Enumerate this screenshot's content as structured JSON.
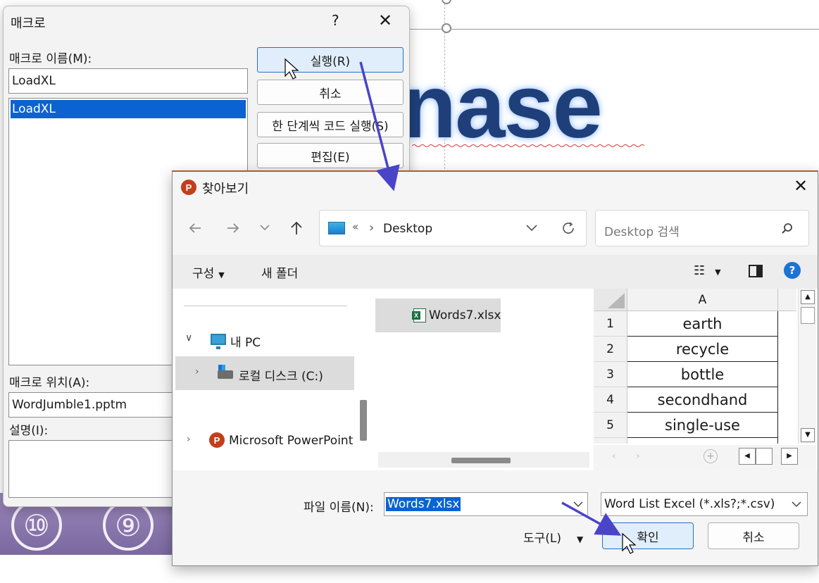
{
  "slide": {
    "word_fragment": "nase",
    "circle_numbers": [
      "⑩",
      "⑨"
    ]
  },
  "macro_dialog": {
    "title": "매크로",
    "help": "?",
    "close": "✕",
    "name_label": "매크로 이름(M):",
    "name_value": "LoadXL",
    "list_items": [
      "LoadXL"
    ],
    "location_label": "매크로 위치(A):",
    "location_value": "WordJumble1.pptm",
    "description_label": "설명(I):",
    "buttons": {
      "run": "실행(R)",
      "cancel": "취소",
      "step": "한 단계씩 코드 실행(S)",
      "edit": "편집(E)"
    }
  },
  "browse_dialog": {
    "app_icon": "P",
    "title": "찾아보기",
    "close": "✕",
    "breadcrumb_prefix": "«",
    "breadcrumb_sep": "›",
    "breadcrumb_current": "Desktop",
    "search_placeholder": "Desktop 검색",
    "toolbar": {
      "organize": "구성",
      "new_folder": "새 폴더"
    },
    "nav": {
      "this_pc": "내 PC",
      "local_disk": "로컬 디스크 (C:)",
      "powerpoint": "Microsoft PowerPoint"
    },
    "file": "Words7.xlsx",
    "preview": {
      "column_header": "A",
      "rows": [
        {
          "n": "1",
          "v": "earth"
        },
        {
          "n": "2",
          "v": "recycle"
        },
        {
          "n": "3",
          "v": "bottle"
        },
        {
          "n": "4",
          "v": "secondhand"
        },
        {
          "n": "5",
          "v": "single-use"
        }
      ]
    },
    "filename_label": "파일 이름(N):",
    "filename_value": "Words7.xlsx",
    "filetype_value": "Word List Excel (*.xls?;*.csv)",
    "tools_label": "도구(L)",
    "ok": "확인",
    "cancel": "취소"
  },
  "colors": {
    "accent": "#2a6fc1",
    "selection": "#0a63d0",
    "annotation_arrow": "#4a44c8"
  }
}
